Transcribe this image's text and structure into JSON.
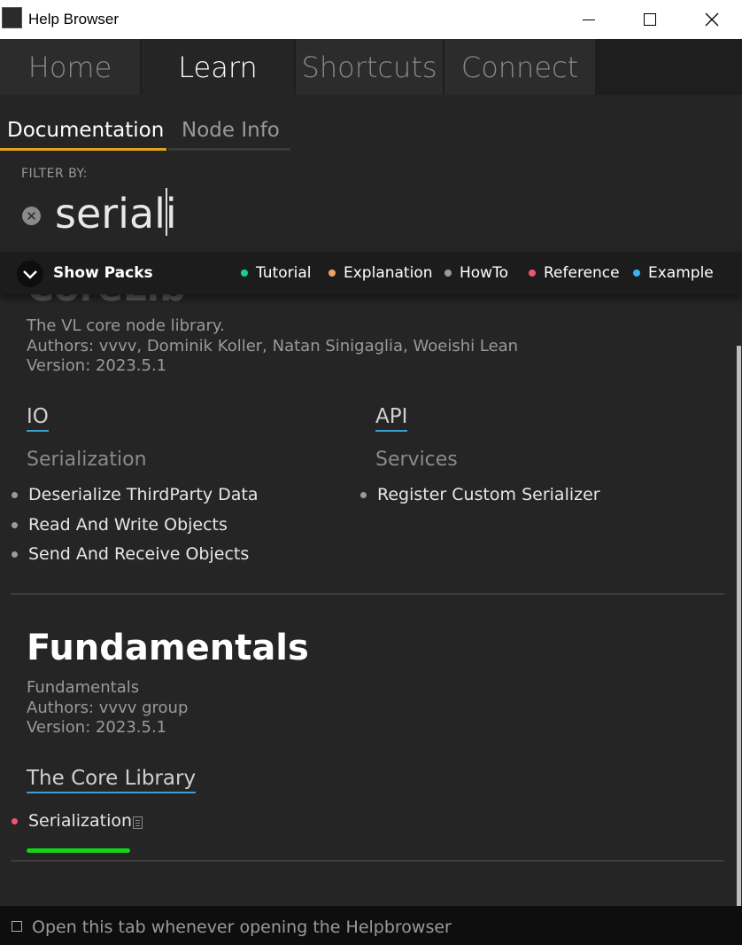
{
  "window": {
    "title": "Help Browser"
  },
  "main_tabs": [
    {
      "label": "Home"
    },
    {
      "label": "Learn"
    },
    {
      "label": "Shortcuts"
    },
    {
      "label": "Connect"
    }
  ],
  "sub_tabs": [
    {
      "label": "Documentation"
    },
    {
      "label": "Node Info"
    }
  ],
  "filter": {
    "label": "FILTER BY:",
    "value": "seriali"
  },
  "packs_bar": {
    "toggle_label": "Show Packs",
    "legend": [
      {
        "label": "Tutorial",
        "color": "#19d08a"
      },
      {
        "label": "Explanation",
        "color": "#f2a25e"
      },
      {
        "label": "HowTo",
        "color": "#9a9a9a"
      },
      {
        "label": "Reference",
        "color": "#f2566b"
      },
      {
        "label": "Example",
        "color": "#3ab3f0"
      }
    ]
  },
  "packs": [
    {
      "title": "CoreLib",
      "description": "The VL core node library.",
      "authors": "Authors: vvvv, Dominik Koller, Natan Sinigaglia, Woeishi Lean",
      "version": "Version: 2023.5.1",
      "columns": [
        {
          "category": "IO",
          "subcategory": "Serialization",
          "items": [
            {
              "label": "Deserialize ThirdParty Data"
            },
            {
              "label": "Read And Write Objects"
            },
            {
              "label": "Send And Receive Objects"
            }
          ]
        },
        {
          "category": "API",
          "subcategory": "Services",
          "items": [
            {
              "label": "Register Custom Serializer"
            }
          ]
        }
      ]
    },
    {
      "title": "Fundamentals",
      "description": "Fundamentals",
      "authors": "Authors: vvvv group",
      "version": "Version: 2023.5.1",
      "category": "The Core Library",
      "items": [
        {
          "label": "Serialization",
          "progress": 1.0
        }
      ]
    }
  ],
  "footer": {
    "label": "Open this tab whenever opening the Helpbrowser"
  }
}
